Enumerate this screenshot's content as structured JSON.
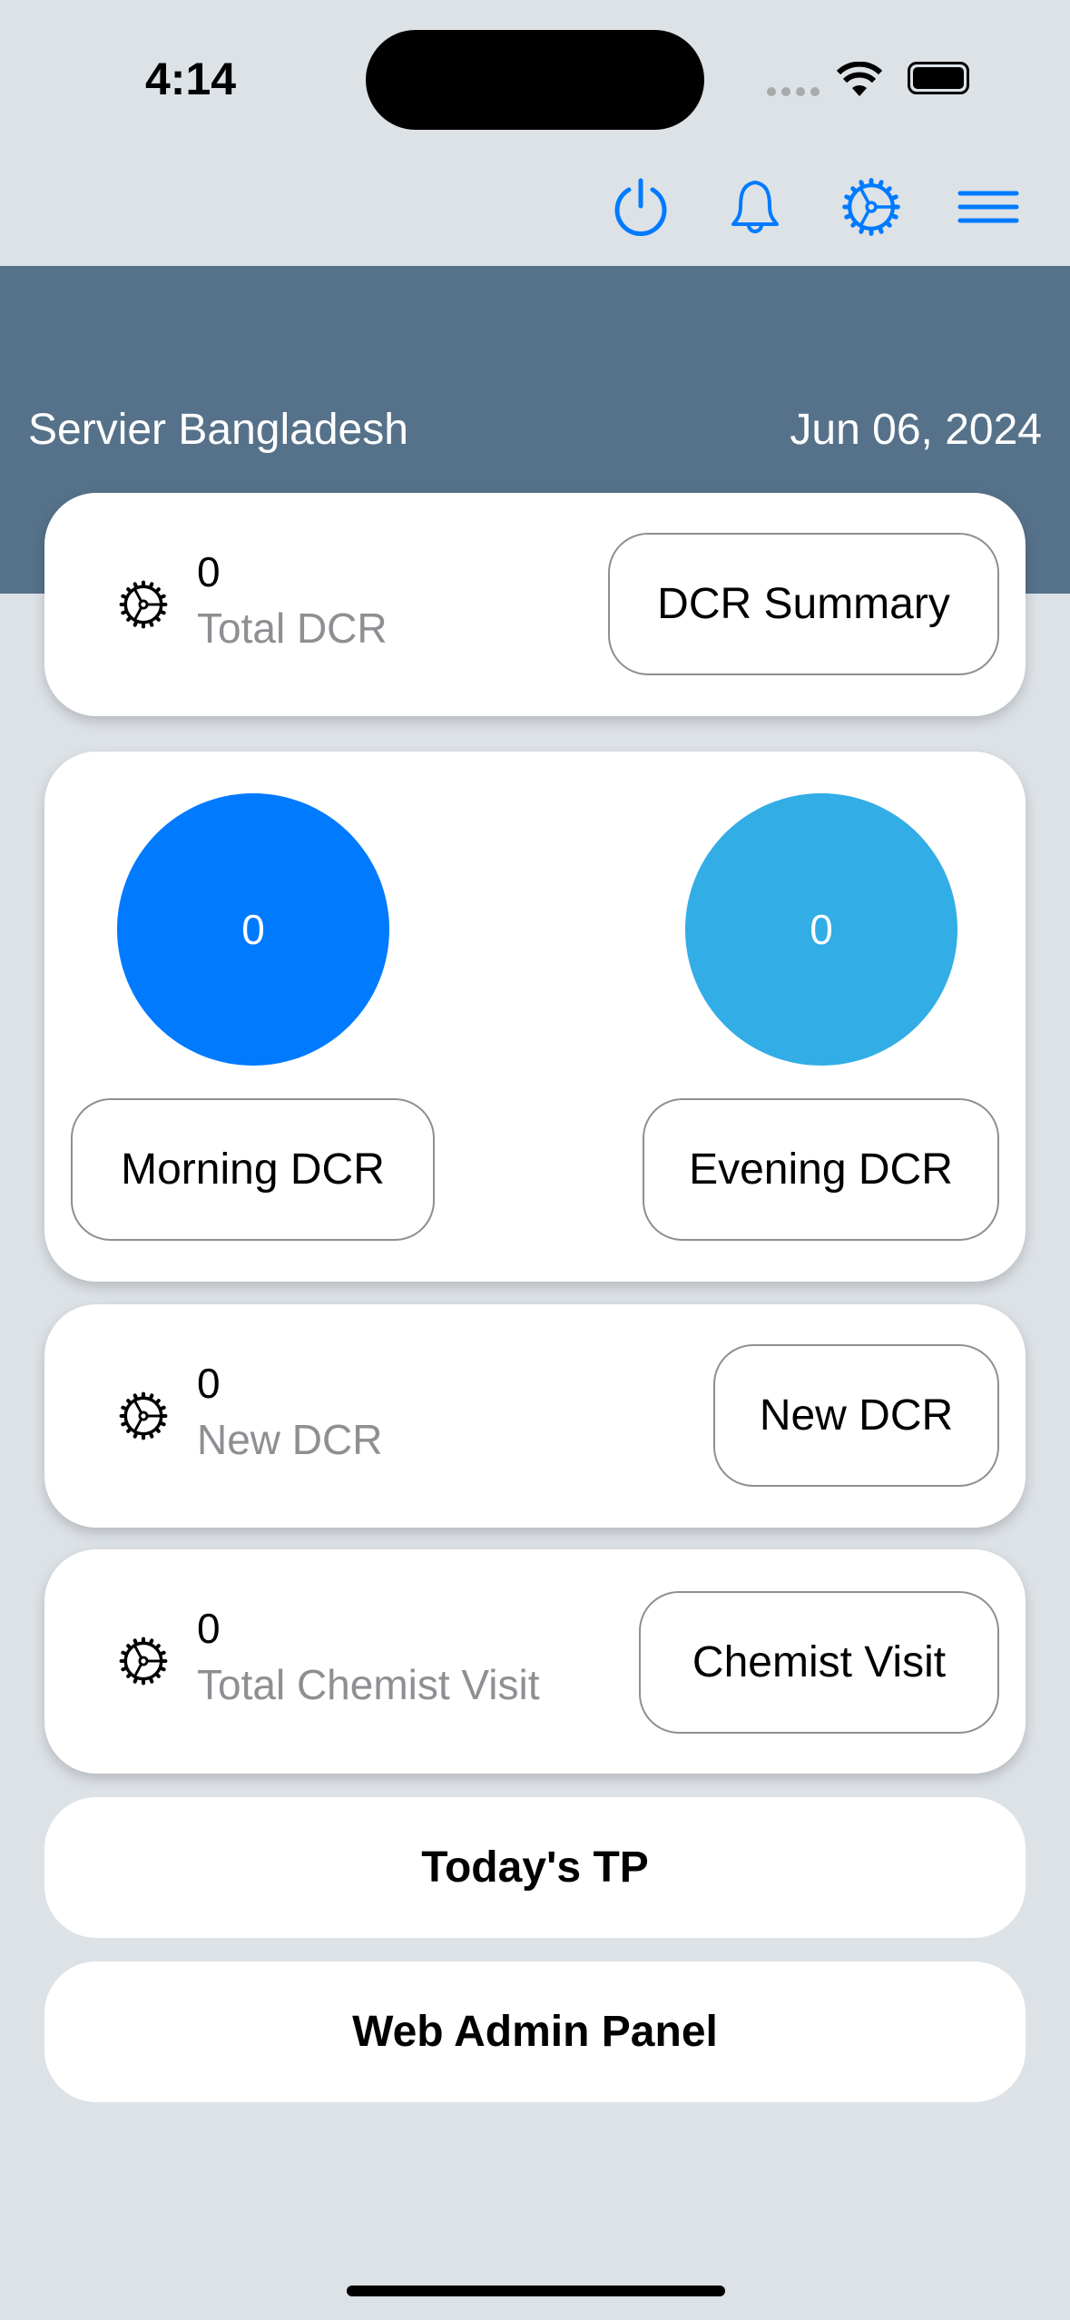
{
  "status_bar": {
    "time": "4:14"
  },
  "toolbar": {
    "icons": [
      "power-icon",
      "bell-icon",
      "gear-icon",
      "menu-icon"
    ],
    "accent": "#007aff"
  },
  "header": {
    "company": "Servier Bangladesh",
    "date": "Jun 06, 2024",
    "color": "#56728a"
  },
  "total_dcr": {
    "value": "0",
    "label": "Total DCR",
    "button": "DCR Summary"
  },
  "shifts": {
    "morning": {
      "value": "0",
      "button": "Morning DCR",
      "color": "#007aff"
    },
    "evening": {
      "value": "0",
      "button": "Evening DCR",
      "color": "#32ade6"
    }
  },
  "new_dcr": {
    "value": "0",
    "label": "New DCR",
    "button": "New DCR"
  },
  "chemist": {
    "value": "0",
    "label": "Total Chemist Visit",
    "button": "Chemist Visit"
  },
  "actions": {
    "todays_tp": "Today's TP",
    "web_admin": "Web Admin Panel"
  }
}
